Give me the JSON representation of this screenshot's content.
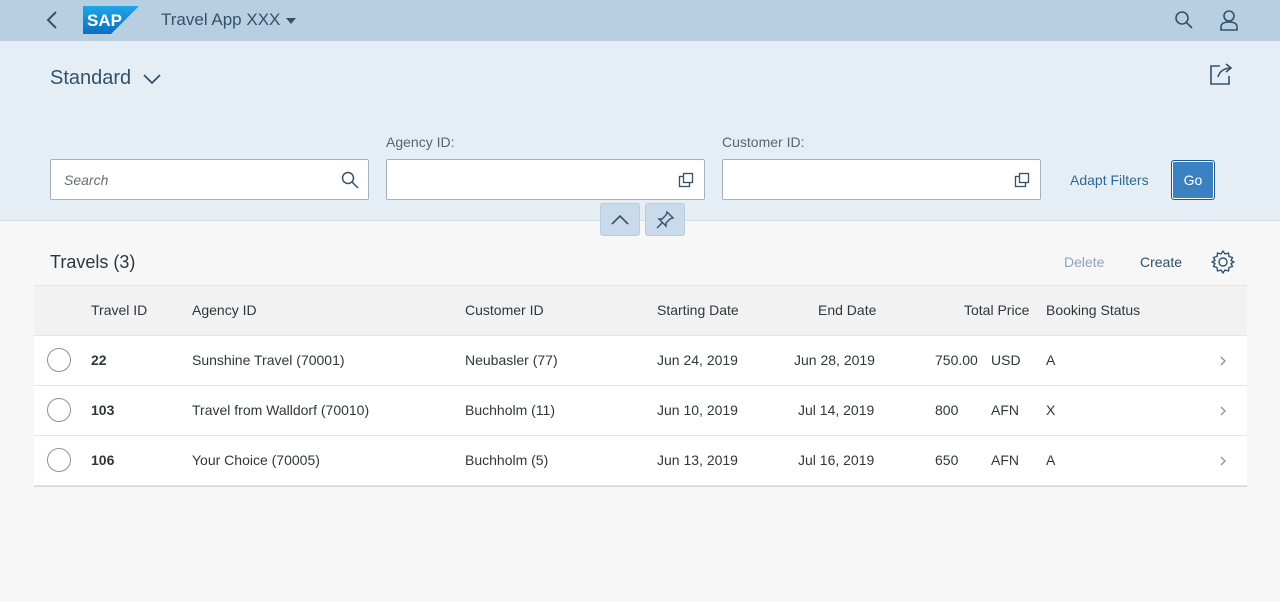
{
  "shell": {
    "app_title": "Travel App XXX",
    "logo_text": "SAP"
  },
  "header": {
    "variant": "Standard"
  },
  "filters": {
    "search_placeholder": "Search",
    "agency_label": "Agency ID:",
    "agency_value": "",
    "customer_label": "Customer ID:",
    "customer_value": "",
    "adapt_filters": "Adapt Filters",
    "go": "Go"
  },
  "table": {
    "title": "Travels (3)",
    "delete": "Delete",
    "create": "Create",
    "columns": [
      "Travel ID",
      "Agency ID",
      "Customer ID",
      "Starting Date",
      "End Date",
      "Total Price",
      "Booking Status"
    ],
    "rows": [
      {
        "travel_id": "22",
        "agency": "Sunshine Travel (70001)",
        "customer": "Neubasler (77)",
        "start": "Jun 24, 2019",
        "end": "Jun 28, 2019",
        "price": "750.00",
        "currency": "USD",
        "status": "A"
      },
      {
        "travel_id": "103",
        "agency": "Travel from Walldorf (70010)",
        "customer": "Buchholm (11)",
        "start": "Jun 10, 2019",
        "end": "Jul 14, 2019",
        "price": "800",
        "currency": "AFN",
        "status": "X"
      },
      {
        "travel_id": "106",
        "agency": "Your Choice (70005)",
        "customer": "Buchholm (5)",
        "start": "Jun 13, 2019",
        "end": "Jul 16, 2019",
        "price": "650",
        "currency": "AFN",
        "status": "A"
      }
    ]
  },
  "colors": {
    "shell_bg": "#b8cfe2",
    "header_bg": "#e6eef5",
    "accent": "#3b80c0",
    "link": "#2e6795"
  }
}
